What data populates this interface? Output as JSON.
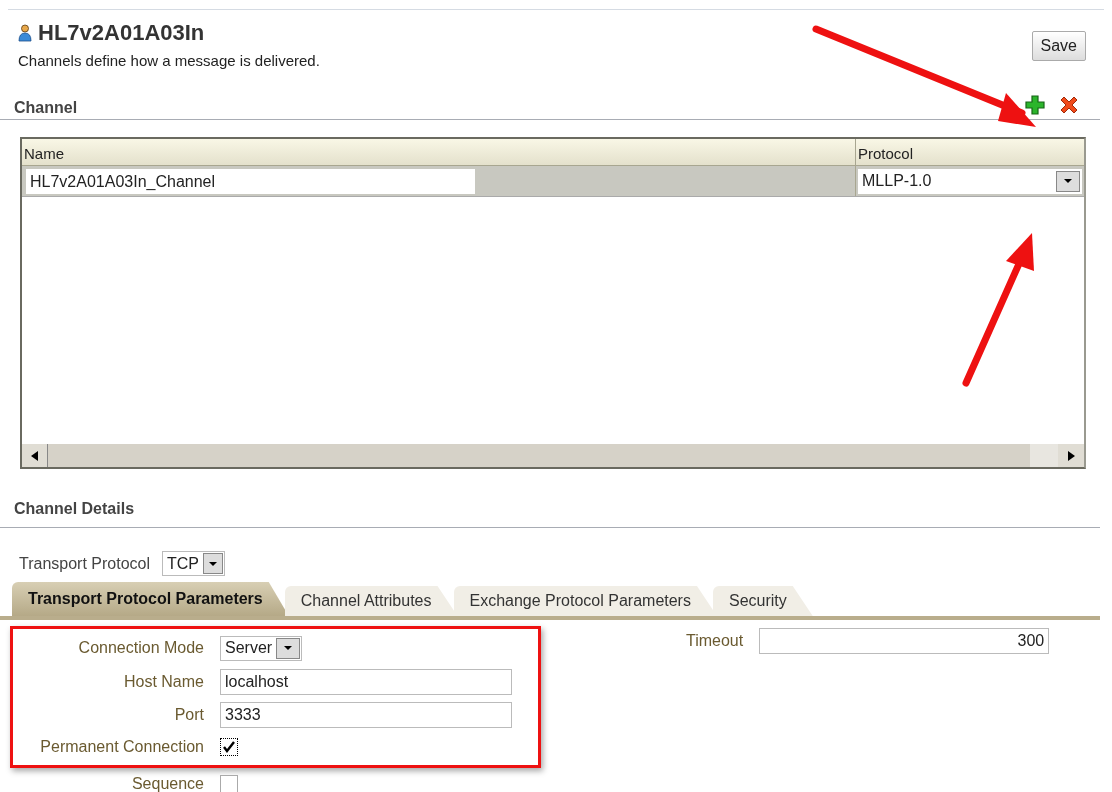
{
  "header": {
    "title": "HL7v2A01A03In",
    "description": "Channels define how a message is delivered.",
    "save": "Save"
  },
  "channel": {
    "heading": "Channel",
    "columns": [
      "Name",
      "Protocol"
    ],
    "rows": [
      {
        "name": "HL7v2A01A03In_Channel",
        "protocol": "MLLP-1.0"
      }
    ]
  },
  "details": {
    "heading": "Channel Details",
    "transport_label": "Transport Protocol",
    "transport_value": "TCP",
    "tabs": [
      {
        "label": "Transport Protocol Parameters",
        "selected": true
      },
      {
        "label": "Channel Attributes",
        "selected": false
      },
      {
        "label": "Exchange Protocol Parameters",
        "selected": false
      },
      {
        "label": "Security",
        "selected": false
      }
    ],
    "fields": [
      {
        "kind": "select",
        "label": "Connection Mode",
        "value": "Server",
        "highlighted": true
      },
      {
        "kind": "text",
        "label": "Host Name",
        "value": "localhost",
        "highlighted": true
      },
      {
        "kind": "text",
        "label": "Port",
        "value": "3333",
        "highlighted": true
      },
      {
        "kind": "checkbox",
        "label": "Permanent Connection",
        "checked": true,
        "highlighted": true
      },
      {
        "kind": "checkbox",
        "label": "Sequence",
        "checked": false,
        "highlighted": false
      }
    ],
    "timeout": {
      "label": "Timeout",
      "value": "300"
    }
  }
}
